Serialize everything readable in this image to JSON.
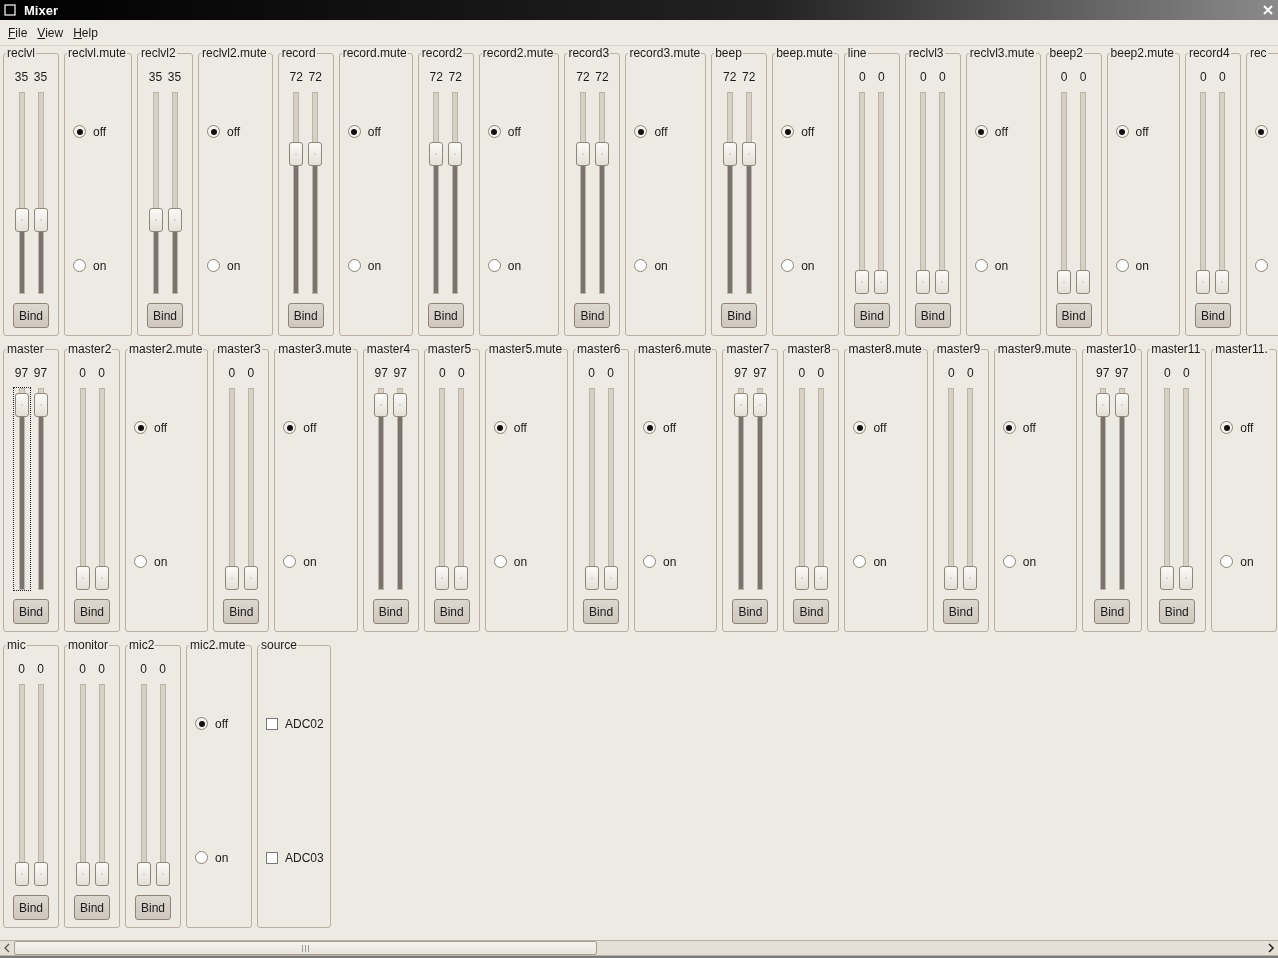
{
  "window": {
    "title": "Mixer"
  },
  "menu": [
    "File",
    "View",
    "Help"
  ],
  "rows": [
    {
      "groups": [
        {
          "kind": "slider",
          "label": "reclvl",
          "channels": [
            {
              "value": "35",
              "level": 0.35,
              "focused": false
            },
            {
              "value": "35",
              "level": 0.35,
              "focused": false
            }
          ],
          "button": "Bind"
        },
        {
          "kind": "mute",
          "label": "reclvl.mute",
          "options": [
            {
              "label": "off",
              "selected": true
            },
            {
              "label": "on",
              "selected": false
            }
          ]
        },
        {
          "kind": "slider",
          "label": "reclvl2",
          "channels": [
            {
              "value": "35",
              "level": 0.35,
              "focused": false
            },
            {
              "value": "35",
              "level": 0.35,
              "focused": false
            }
          ],
          "button": "Bind"
        },
        {
          "kind": "mute",
          "label": "reclvl2.mute",
          "options": [
            {
              "label": "off",
              "selected": true
            },
            {
              "label": "on",
              "selected": false
            }
          ]
        },
        {
          "kind": "slider",
          "label": "record",
          "channels": [
            {
              "value": "72",
              "level": 0.72,
              "focused": false
            },
            {
              "value": "72",
              "level": 0.72,
              "focused": false
            }
          ],
          "button": "Bind"
        },
        {
          "kind": "mute",
          "label": "record.mute",
          "options": [
            {
              "label": "off",
              "selected": true
            },
            {
              "label": "on",
              "selected": false
            }
          ]
        },
        {
          "kind": "slider",
          "label": "record2",
          "channels": [
            {
              "value": "72",
              "level": 0.72,
              "focused": false
            },
            {
              "value": "72",
              "level": 0.72,
              "focused": false
            }
          ],
          "button": "Bind"
        },
        {
          "kind": "mute",
          "label": "record2.mute",
          "options": [
            {
              "label": "off",
              "selected": true
            },
            {
              "label": "on",
              "selected": false
            }
          ]
        },
        {
          "kind": "slider",
          "label": "record3",
          "channels": [
            {
              "value": "72",
              "level": 0.72,
              "focused": false
            },
            {
              "value": "72",
              "level": 0.72,
              "focused": false
            }
          ],
          "button": "Bind"
        },
        {
          "kind": "mute",
          "label": "record3.mute",
          "options": [
            {
              "label": "off",
              "selected": true
            },
            {
              "label": "on",
              "selected": false
            }
          ]
        },
        {
          "kind": "slider",
          "label": "beep",
          "channels": [
            {
              "value": "72",
              "level": 0.72,
              "focused": false
            },
            {
              "value": "72",
              "level": 0.72,
              "focused": false
            }
          ],
          "button": "Bind"
        },
        {
          "kind": "mute",
          "label": "beep.mute",
          "options": [
            {
              "label": "off",
              "selected": true
            },
            {
              "label": "on",
              "selected": false
            }
          ]
        },
        {
          "kind": "slider",
          "label": "line",
          "channels": [
            {
              "value": "0",
              "level": 0,
              "focused": false
            },
            {
              "value": "0",
              "level": 0,
              "focused": false
            }
          ],
          "button": "Bind"
        },
        {
          "kind": "slider",
          "label": "reclvl3",
          "channels": [
            {
              "value": "0",
              "level": 0,
              "focused": false
            },
            {
              "value": "0",
              "level": 0,
              "focused": false
            }
          ],
          "button": "Bind"
        },
        {
          "kind": "mute",
          "label": "reclvl3.mute",
          "options": [
            {
              "label": "off",
              "selected": true
            },
            {
              "label": "on",
              "selected": false
            }
          ]
        },
        {
          "kind": "slider",
          "label": "beep2",
          "channels": [
            {
              "value": "0",
              "level": 0,
              "focused": false
            },
            {
              "value": "0",
              "level": 0,
              "focused": false
            }
          ],
          "button": "Bind"
        },
        {
          "kind": "mute",
          "label": "beep2.mute",
          "options": [
            {
              "label": "off",
              "selected": true
            },
            {
              "label": "on",
              "selected": false
            }
          ]
        },
        {
          "kind": "slider",
          "label": "record4",
          "channels": [
            {
              "value": "0",
              "level": 0,
              "focused": false
            },
            {
              "value": "0",
              "level": 0,
              "focused": false
            }
          ],
          "button": "Bind"
        },
        {
          "kind": "mute",
          "label": "rec",
          "options": [
            {
              "selected": true
            },
            {
              "selected": false
            }
          ]
        }
      ]
    },
    {
      "groups": [
        {
          "kind": "slider",
          "label": "master",
          "channels": [
            {
              "value": "97",
              "level": 0.97,
              "focused": true
            },
            {
              "value": "97",
              "level": 0.97,
              "focused": false
            }
          ],
          "button": "Bind"
        },
        {
          "kind": "slider",
          "label": "master2",
          "channels": [
            {
              "value": "0",
              "level": 0,
              "focused": false
            },
            {
              "value": "0",
              "level": 0,
              "focused": false
            }
          ],
          "button": "Bind"
        },
        {
          "kind": "mute",
          "label": "master2.mute",
          "options": [
            {
              "label": "off",
              "selected": true
            },
            {
              "label": "on",
              "selected": false
            }
          ]
        },
        {
          "kind": "slider",
          "label": "master3",
          "channels": [
            {
              "value": "0",
              "level": 0,
              "focused": false
            },
            {
              "value": "0",
              "level": 0,
              "focused": false
            }
          ],
          "button": "Bind"
        },
        {
          "kind": "mute",
          "label": "master3.mute",
          "options": [
            {
              "label": "off",
              "selected": true
            },
            {
              "label": "on",
              "selected": false
            }
          ]
        },
        {
          "kind": "slider",
          "label": "master4",
          "channels": [
            {
              "value": "97",
              "level": 0.97,
              "focused": false
            },
            {
              "value": "97",
              "level": 0.97,
              "focused": false
            }
          ],
          "button": "Bind"
        },
        {
          "kind": "slider",
          "label": "master5",
          "channels": [
            {
              "value": "0",
              "level": 0,
              "focused": false
            },
            {
              "value": "0",
              "level": 0,
              "focused": false
            }
          ],
          "button": "Bind"
        },
        {
          "kind": "mute",
          "label": "master5.mute",
          "options": [
            {
              "label": "off",
              "selected": true
            },
            {
              "label": "on",
              "selected": false
            }
          ]
        },
        {
          "kind": "slider",
          "label": "master6",
          "channels": [
            {
              "value": "0",
              "level": 0,
              "focused": false
            },
            {
              "value": "0",
              "level": 0,
              "focused": false
            }
          ],
          "button": "Bind"
        },
        {
          "kind": "mute",
          "label": "master6.mute",
          "options": [
            {
              "label": "off",
              "selected": true
            },
            {
              "label": "on",
              "selected": false
            }
          ]
        },
        {
          "kind": "slider",
          "label": "master7",
          "channels": [
            {
              "value": "97",
              "level": 0.97,
              "focused": false
            },
            {
              "value": "97",
              "level": 0.97,
              "focused": false
            }
          ],
          "button": "Bind"
        },
        {
          "kind": "slider",
          "label": "master8",
          "channels": [
            {
              "value": "0",
              "level": 0,
              "focused": false
            },
            {
              "value": "0",
              "level": 0,
              "focused": false
            }
          ],
          "button": "Bind"
        },
        {
          "kind": "mute",
          "label": "master8.mute",
          "options": [
            {
              "label": "off",
              "selected": true
            },
            {
              "label": "on",
              "selected": false
            }
          ]
        },
        {
          "kind": "slider",
          "label": "master9",
          "channels": [
            {
              "value": "0",
              "level": 0,
              "focused": false
            },
            {
              "value": "0",
              "level": 0,
              "focused": false
            }
          ],
          "button": "Bind"
        },
        {
          "kind": "mute",
          "label": "master9.mute",
          "options": [
            {
              "label": "off",
              "selected": true
            },
            {
              "label": "on",
              "selected": false
            }
          ]
        },
        {
          "kind": "slider",
          "label": "master10",
          "channels": [
            {
              "value": "97",
              "level": 0.97,
              "focused": false
            },
            {
              "value": "97",
              "level": 0.97,
              "focused": false
            }
          ],
          "button": "Bind"
        },
        {
          "kind": "slider",
          "label": "master11",
          "channels": [
            {
              "value": "0",
              "level": 0,
              "focused": false
            },
            {
              "value": "0",
              "level": 0,
              "focused": false
            }
          ],
          "button": "Bind"
        },
        {
          "kind": "mute",
          "label": "master11.",
          "options": [
            {
              "label": "off",
              "selected": true
            },
            {
              "label": "on",
              "selected": false
            }
          ]
        }
      ]
    },
    {
      "groups": [
        {
          "kind": "slider",
          "label": "mic",
          "channels": [
            {
              "value": "0",
              "level": 0,
              "focused": false
            },
            {
              "value": "0",
              "level": 0,
              "focused": false
            }
          ],
          "button": "Bind"
        },
        {
          "kind": "slider",
          "label": "monitor",
          "channels": [
            {
              "value": "0",
              "level": 0,
              "focused": false
            },
            {
              "value": "0",
              "level": 0,
              "focused": false
            }
          ],
          "button": "Bind"
        },
        {
          "kind": "slider",
          "label": "mic2",
          "channels": [
            {
              "value": "0",
              "level": 0,
              "focused": false
            },
            {
              "value": "0",
              "level": 0,
              "focused": false
            }
          ],
          "button": "Bind"
        },
        {
          "kind": "mute",
          "label": "mic2.mute",
          "options": [
            {
              "label": "off",
              "selected": true
            },
            {
              "label": "on",
              "selected": false
            }
          ]
        },
        {
          "kind": "checks",
          "label": "source",
          "options": [
            {
              "label": "ADC02",
              "checked": false
            },
            {
              "label": "ADC03",
              "checked": false
            }
          ]
        }
      ]
    }
  ]
}
